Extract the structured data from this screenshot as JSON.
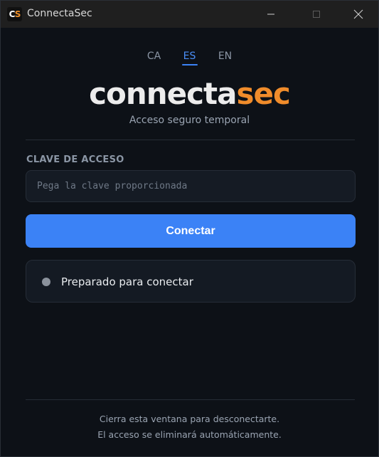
{
  "window": {
    "title": "ConnectaSec",
    "icon_letters": [
      "C",
      "S"
    ]
  },
  "languages": [
    {
      "code": "CA",
      "active": false
    },
    {
      "code": "ES",
      "active": true
    },
    {
      "code": "EN",
      "active": false
    }
  ],
  "logo": {
    "part1": "connecta",
    "part2": "sec"
  },
  "subtitle": "Acceso seguro temporal",
  "form": {
    "label": "CLAVE DE ACCESO",
    "input_value": "",
    "placeholder": "Pega la clave proporcionada",
    "button_label": "Conectar"
  },
  "status": {
    "text": "Preparado para conectar"
  },
  "footer": {
    "line1": "Cierra esta ventana para desconectarte.",
    "line2": "El acceso se eliminará automáticamente."
  },
  "colors": {
    "accent": "#3b82f6",
    "brand_orange": "#f08c2b",
    "background": "#0d1117",
    "status_idle": "#8b929c"
  }
}
